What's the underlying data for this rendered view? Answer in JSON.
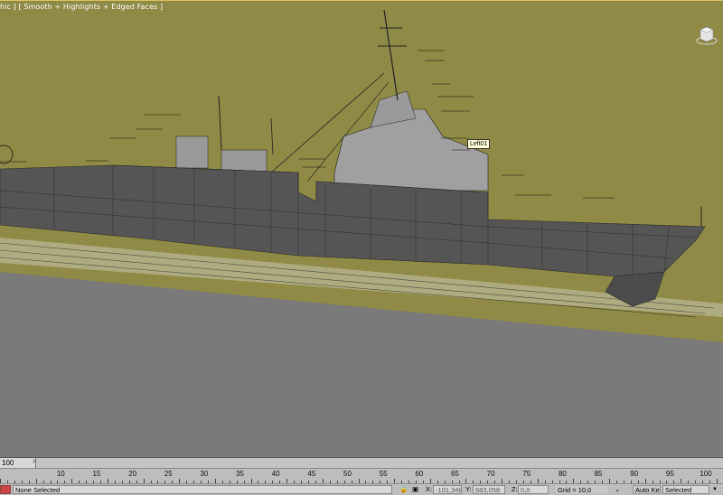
{
  "viewport": {
    "label": "hic ] [ Smooth + Highlights + Edged Faces ]",
    "object_tag": "Left01",
    "colors": {
      "background": "#7a7a7a",
      "plane": "#8f8a45",
      "hull": "#555555"
    }
  },
  "timeline": {
    "frame_counter": "100",
    "arrow": ">"
  },
  "ruler": {
    "labels": [
      "10",
      "15",
      "20",
      "25",
      "30",
      "35",
      "40",
      "45",
      "50",
      "55",
      "60",
      "65",
      "70",
      "75",
      "80",
      "85",
      "90",
      "95",
      "100"
    ]
  },
  "status": {
    "selection": "None Selected",
    "x_label": "X:",
    "x_value": "-101,348",
    "y_label": "Y:",
    "y_value": "683,058",
    "z_label": "Z:",
    "z_value": "0,0",
    "grid": "Grid = 10,0",
    "auto_key": "Auto Key",
    "selected_option": "Selected"
  }
}
